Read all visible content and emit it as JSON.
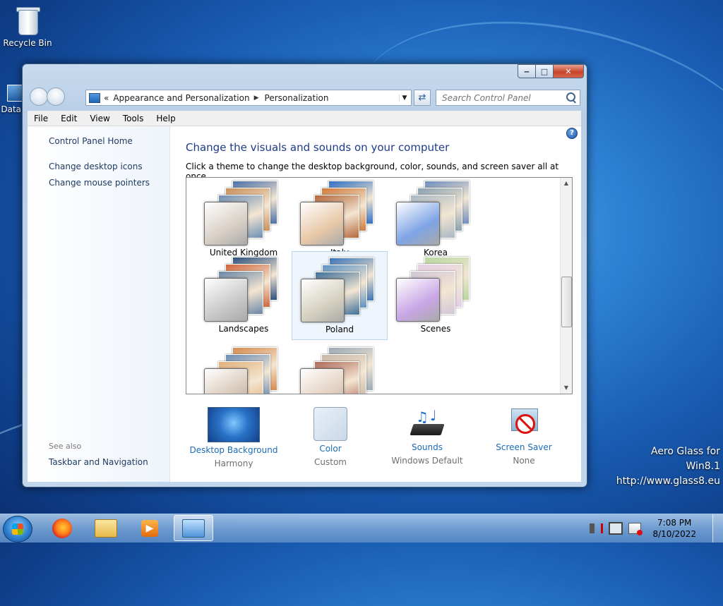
{
  "desktop": {
    "recycle_bin_label": "Recycle Bin",
    "partial_icon_label": "Data"
  },
  "window": {
    "title_controls": {
      "minimize": "‒",
      "maximize": "□",
      "close": "✕"
    },
    "address": {
      "prefix": "«",
      "crumb_1": "Appearance and Personalization",
      "separator": "▶",
      "crumb_2": "Personalization",
      "dropdown": "▼"
    },
    "refresh_icon": "⇄",
    "search_placeholder": "Search Control Panel",
    "menu": [
      "File",
      "Edit",
      "View",
      "Tools",
      "Help"
    ],
    "left_pane": {
      "home": "Control Panel Home",
      "links": [
        "Change desktop icons",
        "Change mouse pointers"
      ],
      "see_also": "See also",
      "see_also_links": [
        "Taskbar and Navigation"
      ]
    },
    "help_glyph": "?",
    "main_title": "Change the visuals and sounds on your computer",
    "subtitle": "Click a theme to change the desktop background, color, sounds, and screen saver all at once.",
    "themes": [
      {
        "name": "United Kingdom",
        "colors": [
          "#4a6fa8",
          "#c98f5a",
          "#6e8fb5"
        ],
        "front": "#d8cfc6",
        "selected": false
      },
      {
        "name": "Italy",
        "colors": [
          "#2f6fc4",
          "#d07a3a",
          "#b5683c"
        ],
        "front": "#e8c8a8",
        "selected": false
      },
      {
        "name": "Korea",
        "colors": [
          "#6e8dbd",
          "#8aa0b0",
          "#a9b8c4"
        ],
        "front": "#7fa4e6",
        "selected": false
      },
      {
        "name": "Landscapes",
        "colors": [
          "#2b4f7e",
          "#d0663a",
          "#6b86a6"
        ],
        "front": "#c9c9c9",
        "selected": false
      },
      {
        "name": "Poland",
        "colors": [
          "#3a73b8",
          "#5c92c4",
          "#3f6f9a"
        ],
        "front": "#d5d1c0",
        "selected": true
      },
      {
        "name": "Scenes",
        "colors": [
          "#b9d6a0",
          "#e4cde6",
          "#d1c6d8"
        ],
        "front": "#c9a6e6",
        "selected": false
      },
      {
        "name": "",
        "colors": [
          "#d68b4e",
          "#6b8bb5",
          "#e2b07a"
        ],
        "front": "#d8c8b8",
        "selected": false
      },
      {
        "name": "",
        "colors": [
          "#9aa9b8",
          "#c9b8a6",
          "#b06a5a"
        ],
        "front": "#e3d0c0",
        "selected": false
      }
    ],
    "scroll": {
      "up": "▲",
      "down": "▼"
    },
    "bottom": [
      {
        "link": "Desktop Background",
        "value": "Harmony"
      },
      {
        "link": "Color",
        "value": "Custom"
      },
      {
        "link": "Sounds",
        "value": "Windows Default"
      },
      {
        "link": "Screen Saver",
        "value": "None"
      }
    ]
  },
  "watermark": {
    "line1": "Aero Glass for Win8.1",
    "line2": "http://www.glass8.eu"
  },
  "taskbar": {
    "clock_time": "7:08 PM",
    "clock_date": "8/10/2022",
    "icons": [
      "start-orb-icon",
      "firefox-icon",
      "file-explorer-icon",
      "media-player-icon",
      "control-panel-icon"
    ]
  },
  "colors": {
    "link": "#1a6bb6",
    "title": "#1e3b8a",
    "desktop": "#1a5fb6"
  }
}
